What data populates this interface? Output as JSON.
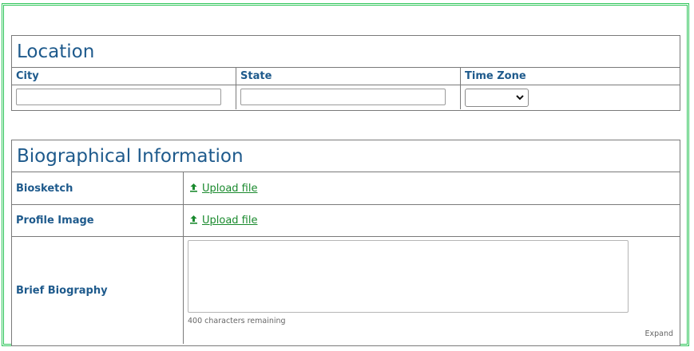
{
  "location": {
    "title": "Location",
    "columns": [
      "City",
      "State",
      "Time Zone"
    ],
    "city_value": "",
    "state_value": "",
    "timezone_value": ""
  },
  "bio": {
    "title": "Biographical Information",
    "rows": [
      {
        "label": "Biosketch",
        "action": "Upload file",
        "icon": "upload-icon"
      },
      {
        "label": "Profile Image",
        "action": "Upload file",
        "icon": "upload-icon"
      }
    ],
    "brief_label": "Brief Biography",
    "brief_value": "",
    "remaining": "400 characters remaining",
    "expand": "Expand"
  },
  "colors": {
    "frame": "#2ec55a",
    "heading": "#1e5a8c",
    "link": "#1a8a2e"
  }
}
